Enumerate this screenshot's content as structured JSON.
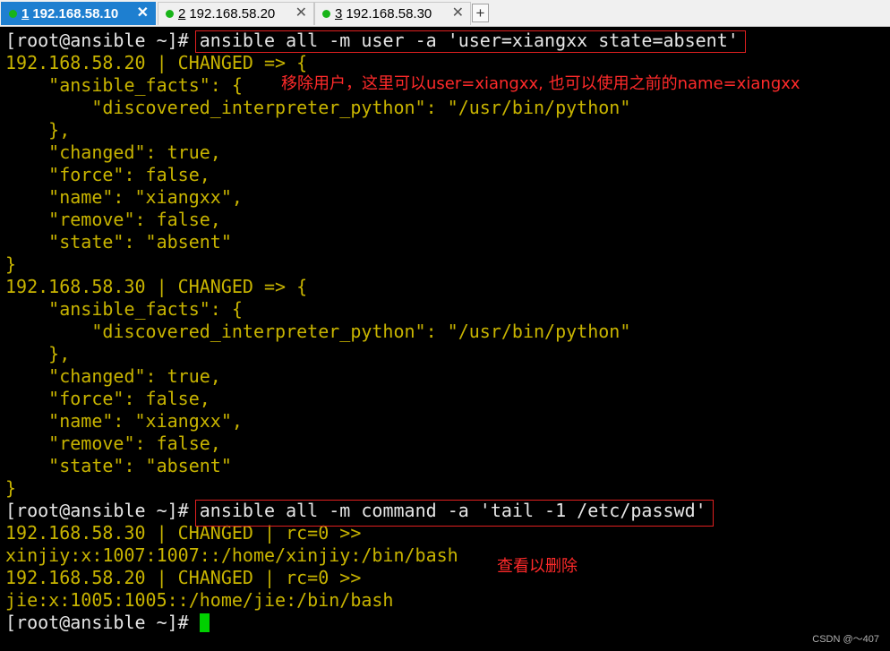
{
  "tabs": [
    {
      "num": "1",
      "label": "192.168.58.10",
      "active": true
    },
    {
      "num": "2",
      "label": "192.168.58.20",
      "active": false
    },
    {
      "num": "3",
      "label": "192.168.58.30",
      "active": false
    }
  ],
  "tab_close_glyph": "✕",
  "add_tab_glyph": "+",
  "terminal": {
    "prompt": "[root@ansible ~]#",
    "cmd1": " ansible all -m user -a 'user=xiangxx state=absent'",
    "l1": "192.168.58.20 | CHANGED => {",
    "l2": "    \"ansible_facts\": {",
    "l3": "        \"discovered_interpreter_python\": \"/usr/bin/python\"",
    "l4": "    },",
    "l5": "    \"changed\": true,",
    "l6": "    \"force\": false,",
    "l7": "    \"name\": \"xiangxx\",",
    "l8": "    \"remove\": false,",
    "l9": "    \"state\": \"absent\"",
    "l10": "}",
    "l11": "192.168.58.30 | CHANGED => {",
    "l12": "    \"ansible_facts\": {",
    "l13": "        \"discovered_interpreter_python\": \"/usr/bin/python\"",
    "l14": "    },",
    "l15": "    \"changed\": true,",
    "l16": "    \"force\": false,",
    "l17": "    \"name\": \"xiangxx\",",
    "l18": "    \"remove\": false,",
    "l19": "    \"state\": \"absent\"",
    "l20": "}",
    "cmd2": " ansible all -m command -a 'tail -1 /etc/passwd'",
    "l22": "192.168.58.30 | CHANGED | rc=0 >>",
    "l23": "xinjiy:x:1007:1007::/home/xinjiy:/bin/bash",
    "l24": "192.168.58.20 | CHANGED | rc=0 >>",
    "l25": "jie:x:1005:1005::/home/jie:/bin/bash"
  },
  "annotations": {
    "note1": "移除用户，这里可以user=xiangxx, 也可以使用之前的name=xiangxx",
    "note2": "查看以删除"
  },
  "watermark": "CSDN @～407",
  "colors": {
    "output": "#c8b400",
    "text": "#e6e6e6",
    "annotation": "#ff2a2a",
    "active_tab": "#1e7fd0",
    "cursor": "#00d000"
  }
}
